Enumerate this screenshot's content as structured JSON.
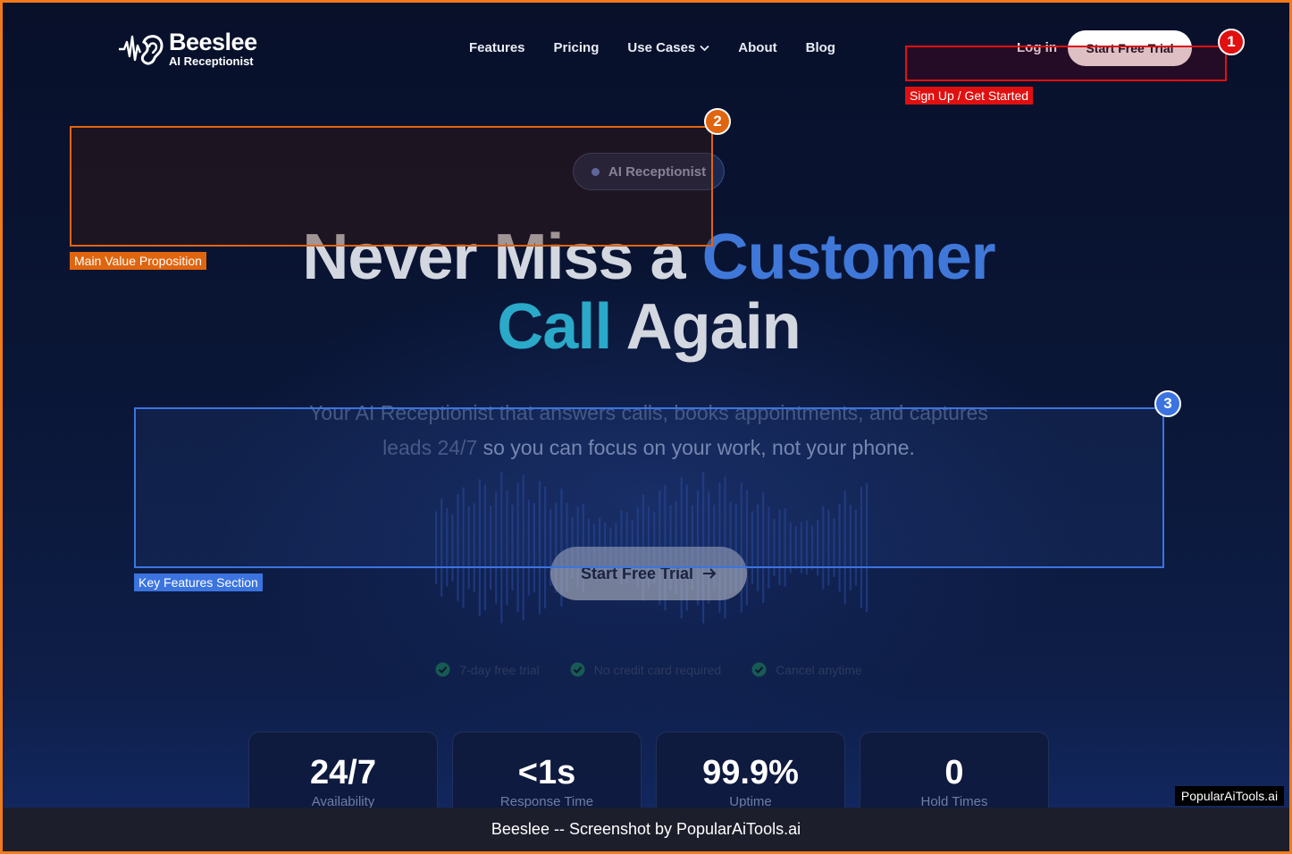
{
  "brand": {
    "name": "Beeslee",
    "tagline": "AI Receptionist"
  },
  "nav": {
    "items": [
      {
        "label": "Features"
      },
      {
        "label": "Pricing"
      },
      {
        "label": "Use Cases",
        "has_dropdown": true
      },
      {
        "label": "About"
      },
      {
        "label": "Blog"
      }
    ],
    "login_label": "Log in",
    "trial_label": "Start Free Trial"
  },
  "hero": {
    "badge": "AI Receptionist",
    "headline": {
      "part1": "Never Miss a ",
      "part2": "Customer",
      "part3": "Call",
      "part4": " Again"
    },
    "subtitle": {
      "part1": "Your AI Receptionist that answers calls, books appointments, and captures leads 24/7",
      "part2": " so you can focus on your work, not your phone."
    },
    "cta_label": "Start Free Trial",
    "checks": [
      "7-day free trial",
      "No credit card required",
      "Cancel anytime"
    ]
  },
  "stats": [
    {
      "value": "24/7",
      "label": "Availability"
    },
    {
      "value": "<1s",
      "label": "Response Time"
    },
    {
      "value": "99.9%",
      "label": "Uptime"
    },
    {
      "value": "0",
      "label": "Hold Times"
    }
  ],
  "annotations": [
    {
      "number": "1",
      "label": "Sign Up / Get Started",
      "color": "#e01010"
    },
    {
      "number": "2",
      "label": "Main Value Proposition",
      "color": "#e0650f"
    },
    {
      "number": "3",
      "label": "Key Features Section",
      "color": "#3b74e0"
    }
  ],
  "watermark": "PopularAiTools.ai",
  "footer": "Beeslee -- Screenshot by PopularAiTools.ai",
  "colors": {
    "frame_border": "#f07a1c",
    "accent_blue": "#3f78d8",
    "accent_teal": "#2aa9c9",
    "check_green": "#1f8a5a"
  }
}
